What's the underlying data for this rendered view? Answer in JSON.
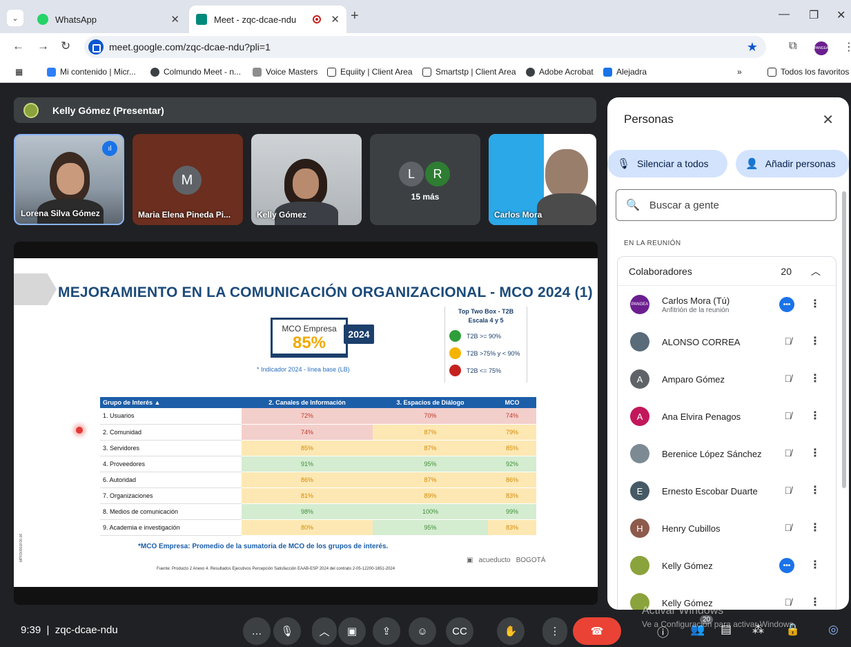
{
  "browser": {
    "tabs": [
      {
        "title": "WhatsApp",
        "active": false
      },
      {
        "title": "Meet - zqc-dcae-ndu",
        "active": true
      }
    ],
    "address": "meet.google.com/zqc-dcae-ndu?pli=1",
    "bookmarks": [
      "Mi contenido | Micr...",
      "Colmundo Meet - n...",
      "Voice Masters",
      "Equiity | Client Area",
      "Smartstp | Client Area",
      "Adobe Acrobat",
      "Alejadra"
    ],
    "all_bookmarks": "Todos los favoritos",
    "profile_label": "PANGEA"
  },
  "meet": {
    "presenter_label": "Kelly Gómez (Presentar)",
    "tiles": [
      {
        "name": "Lorena Silva Gómez"
      },
      {
        "name": "Maria Elena Pineda Pi...",
        "initial": "M"
      },
      {
        "name": "Kelly Gómez"
      },
      {
        "initials": [
          "L",
          "R"
        ],
        "more": "15 más"
      },
      {
        "name": "Carlos Mora"
      }
    ],
    "meeting_time": "9:39",
    "meeting_code": "zqc-dcae-ndu",
    "participant_badge": "20"
  },
  "slide": {
    "title": "MEJORAMIENTO EN LA COMUNICACIÓN ORGANIZACIONAL - MCO 2024 (1)",
    "mco_label": "MCO Empresa",
    "mco_value": "85%",
    "mco_year": "2024",
    "mco_note": "* Indicador 2024 - línea base (LB)",
    "legend_title_1": "Top Two Box - T2B",
    "legend_title_2": "Escala 4 y 5",
    "legend": [
      {
        "label": "T2B >= 90%",
        "color": "#2e9e3a"
      },
      {
        "label": "T2B >75% y < 90%",
        "color": "#f4b400"
      },
      {
        "label": "T2B <= 75%",
        "color": "#c5221f"
      }
    ],
    "table": {
      "headers": [
        "Grupo de Interés ▲",
        "2. Canales de Información",
        "3. Espacios de Diálogo",
        "MCO"
      ],
      "rows": [
        [
          "1. Usuarios",
          "72%",
          "70%",
          "74%"
        ],
        [
          "2. Comunidad",
          "74%",
          "87%",
          "79%"
        ],
        [
          "3. Servidores",
          "85%",
          "87%",
          "85%"
        ],
        [
          "4. Proveedores",
          "91%",
          "95%",
          "92%"
        ],
        [
          "6. Autoridad",
          "86%",
          "87%",
          "86%"
        ],
        [
          "7. Organizaciones",
          "81%",
          "89%",
          "83%"
        ],
        [
          "8. Medios de comunicación",
          "98%",
          "100%",
          "99%"
        ],
        [
          "9. Academia e investigación",
          "80%",
          "95%",
          "83%"
        ]
      ],
      "classes": [
        [
          "c-red",
          "c-red",
          "c-red"
        ],
        [
          "c-red",
          "c-yel",
          "c-yel"
        ],
        [
          "c-yel",
          "c-yel",
          "c-yel"
        ],
        [
          "c-grn",
          "c-grn",
          "c-grn"
        ],
        [
          "c-yel",
          "c-yel",
          "c-yel"
        ],
        [
          "c-yel",
          "c-yel",
          "c-yel"
        ],
        [
          "c-grn",
          "c-grn",
          "c-grn"
        ],
        [
          "c-yel",
          "c-grn",
          "c-yel"
        ]
      ]
    },
    "footnote": "*MCO Empresa: Promedio de la sumatoria de MCO de los grupos de interés.",
    "source": "Fuente: Producto 2 Anexo 4. Resultados Ejecutivos Percepción Satisfacción EAAB-ESP 2024 del contrato 2-05-12200-1651-2024",
    "logo_1": "acueducto",
    "logo_2": "BOGOTÁ",
    "code": "MPFD0801F06-06"
  },
  "people_panel": {
    "title": "Personas",
    "mute_all": "Silenciar a todos",
    "add_people": "Añadir personas",
    "search_placeholder": "Buscar a gente",
    "section": "EN LA REUNIÓN",
    "group_label": "Colaboradores",
    "group_count": "20",
    "participants": [
      {
        "name": "Carlos Mora (Tú)",
        "sub": "Anfitrión de la reunión",
        "avatar": "PANGEA",
        "color": "#6b1f8f",
        "state": "active"
      },
      {
        "name": "ALONSO CORREA",
        "avatar": "",
        "color": "#5a6b7a",
        "state": "muted"
      },
      {
        "name": "Amparo Gómez",
        "avatar": "A",
        "color": "#5f6368",
        "state": "muted"
      },
      {
        "name": "Ana Elvira Penagos",
        "avatar": "A",
        "color": "#c2185b",
        "state": "muted"
      },
      {
        "name": "Berenice López Sánchez",
        "avatar": "",
        "color": "#7c8a94",
        "state": "muted"
      },
      {
        "name": "Ernesto Escobar Duarte",
        "avatar": "E",
        "color": "#455a64",
        "state": "muted"
      },
      {
        "name": "Henry Cubillos",
        "avatar": "H",
        "color": "#8d5b4c",
        "state": "muted"
      },
      {
        "name": "Kelly Gómez",
        "avatar": "",
        "color": "#8aa33c",
        "state": "active"
      },
      {
        "name": "Kelly Gómez",
        "avatar": "",
        "color": "#8aa33c",
        "state": "muted"
      }
    ]
  },
  "watermark": {
    "line1": "Activar Windows",
    "line2": "Ve a Configuración para activar Windows."
  }
}
